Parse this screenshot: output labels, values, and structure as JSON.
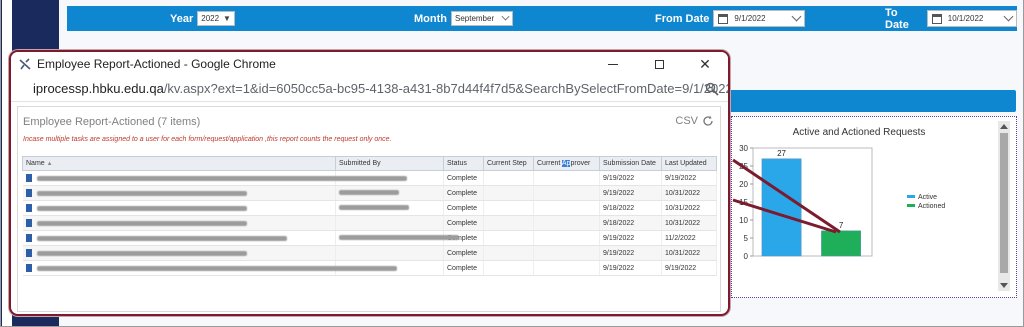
{
  "filters": {
    "year_label": "Year",
    "year_value": "2022",
    "month_label": "Month",
    "month_value": "September",
    "from_label": "From Date",
    "from_value": "9/1/2022",
    "to_label": "To Date",
    "to_value": "10/1/2022"
  },
  "window": {
    "title": "Employee Report-Actioned - Google Chrome",
    "url_host": "iprocessp.hbku.edu.qa",
    "url_rest": "/kv.aspx?ext=1&id=6050cc5a-bc95-4138-a431-8b7d44f4f7d5&SearchBySelectFromDate=9/1/2022..."
  },
  "report": {
    "title": "Employee Report-Actioned (7 items)",
    "csv_label": "CSV",
    "note": "Incase multiple tasks are assigned to a user  for each form/request/application ,this report counts the request only once.",
    "columns": [
      "Name",
      "Submitted By",
      "Status",
      "Current Step",
      "Current Approver",
      "Submission Date",
      "Last Updated"
    ],
    "approver_pre": "Current ",
    "approver_hl": "Ap",
    "approver_post": "prover",
    "rows": [
      {
        "status": "Complete",
        "submitted": "9/19/2022",
        "updated": "9/19/2022"
      },
      {
        "status": "Complete",
        "submitted": "9/19/2022",
        "updated": "10/31/2022"
      },
      {
        "status": "Complete",
        "submitted": "9/18/2022",
        "updated": "10/31/2022"
      },
      {
        "status": "Complete",
        "submitted": "9/18/2022",
        "updated": "10/31/2022"
      },
      {
        "status": "Complete",
        "submitted": "9/19/2022",
        "updated": "11/2/2022"
      },
      {
        "status": "Complete",
        "submitted": "9/19/2022",
        "updated": "10/31/2022"
      },
      {
        "status": "Complete",
        "submitted": "9/19/2022",
        "updated": "9/19/2022"
      }
    ]
  },
  "chart_data": {
    "type": "bar",
    "title": "Active and Actioned Requests",
    "categories": [
      "Active",
      "Actioned"
    ],
    "values": [
      27,
      7
    ],
    "colors": [
      "#2aa7e8",
      "#1fae5a"
    ],
    "ylim": [
      0,
      30
    ],
    "yticks": [
      "0",
      "5",
      "10",
      "15",
      "20",
      "25",
      "30"
    ],
    "legend": [
      "Active",
      "Actioned"
    ],
    "legend_position": "right"
  }
}
